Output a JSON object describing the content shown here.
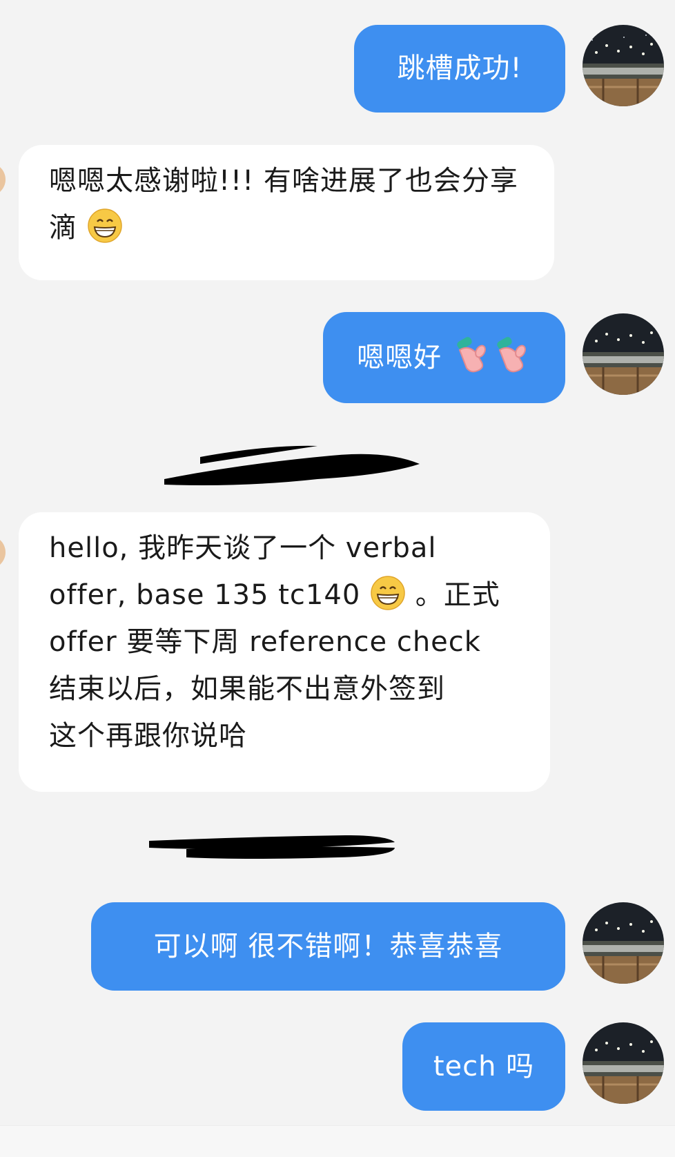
{
  "messages": [
    {
      "from": "me",
      "text": "跳槽成功!"
    },
    {
      "from": "them",
      "text": "嗯嗯太感谢啦!!!  有啥进展了也会分享滴",
      "emoji": "grinning-face-emoji"
    },
    {
      "from": "me",
      "text": "嗯嗯好",
      "emoji": "mittens-emoji"
    },
    {
      "from": "them",
      "lines": [
        "hello, 我昨天谈了一个 verbal",
        "offer, base 135 tc140",
        "。正式",
        "offer 要等下周 reference check",
        "结束以后，如果能不出意外签到",
        "这个再跟你说哈"
      ],
      "emoji": "grinning-face-emoji"
    },
    {
      "from": "me",
      "text": "可以啊 很不错啊！恭喜恭喜"
    },
    {
      "from": "me",
      "text": "tech 吗"
    }
  ],
  "colors": {
    "background": "#f3f3f3",
    "outgoing_bubble": "#3e8ff0",
    "incoming_bubble": "#ffffff",
    "outgoing_text": "#ffffff",
    "incoming_text": "#1a1a1a"
  },
  "icons": {
    "avatar": "night-scene-avatar",
    "emoji_grin": "grinning-face-emoji",
    "emoji_mittens": "mittens-emoji"
  }
}
